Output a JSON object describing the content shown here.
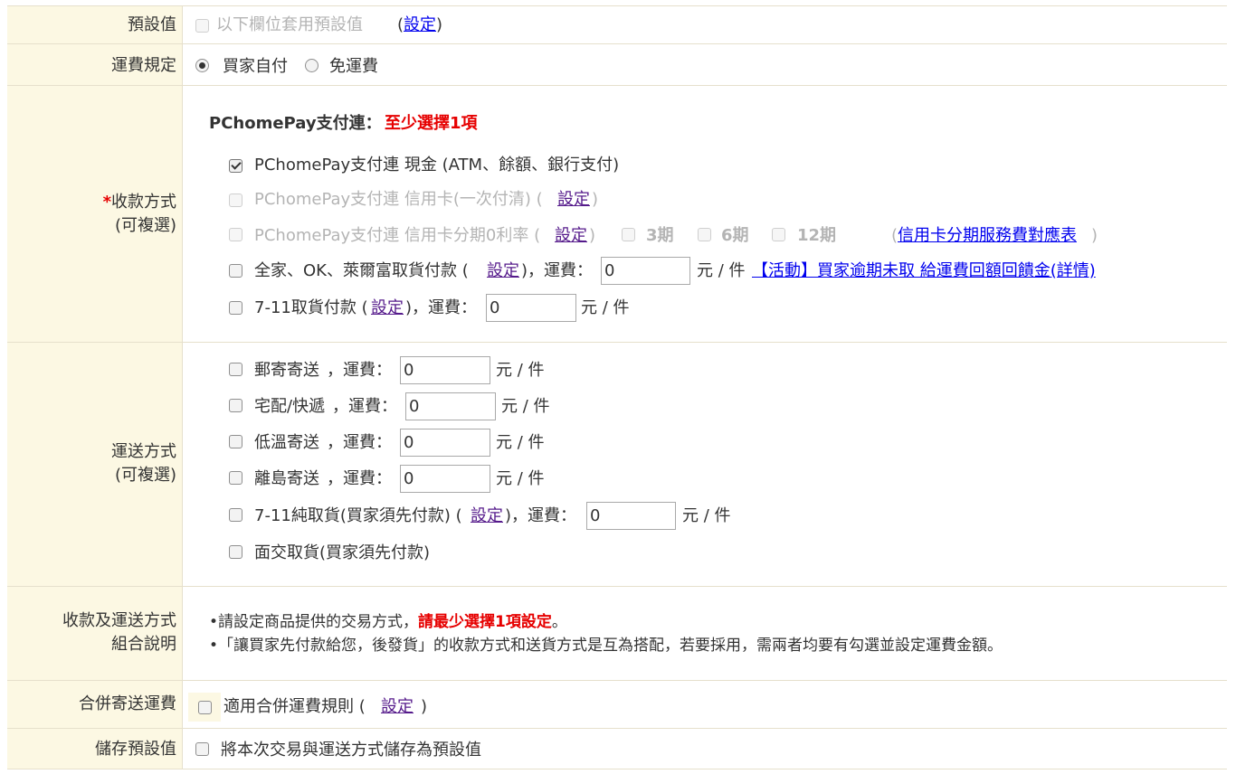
{
  "rows": {
    "default": {
      "label": "預設值",
      "checkbox_label": "以下欄位套用預設值",
      "paren_open": "(",
      "setting_link": "設定",
      "paren_close": ")"
    },
    "shipping_rule": {
      "label": "運費規定",
      "option_buyer_pays": "買家自付",
      "option_free": "免運費",
      "selected": "買家自付"
    },
    "payment": {
      "required_star": "*",
      "label_line1": "收款方式",
      "label_line2": "(可複選)",
      "group_title": "PChomePay支付連：",
      "group_requirement": "至少選擇1項",
      "cash": {
        "label": "PChomePay支付連 現金 (ATM、餘額、銀行支付)",
        "checked": true
      },
      "credit_card": {
        "label": "PChomePay支付連 信用卡(一次付清) (",
        "setting_link": "設定",
        "close": ")"
      },
      "installment": {
        "label": "PChomePay支付連 信用卡分期0利率 (",
        "setting_link": "設定",
        "close": ")",
        "option_3": "3期",
        "option_6": "6期",
        "option_12": "12期",
        "table_open": "(",
        "table_link": "信用卡分期服務費對應表",
        "table_close": ")"
      },
      "family_mart": {
        "label": "全家、OK、萊爾富取貨付款 (",
        "setting_link": "設定",
        "fee_label": ")，運費：",
        "fee_value": "0",
        "unit": "元 / 件",
        "promo_link": "【活動】買家逾期未取 給運費回額回饋金(詳情)"
      },
      "seven_eleven": {
        "label": "7-11取貨付款 (",
        "setting_link": "設定",
        "fee_label": ")，運費：",
        "fee_value": "0",
        "unit": "元 / 件"
      }
    },
    "delivery": {
      "label_line1": "運送方式",
      "label_line2": "(可複選)",
      "post": {
        "label": "郵寄寄送",
        "fee_label": "，運費：",
        "fee_value": "0",
        "unit": "元 / 件"
      },
      "home": {
        "label": "宅配/快遞",
        "fee_label": "，運費：",
        "fee_value": "0",
        "unit": "元 / 件"
      },
      "cold": {
        "label": "低溫寄送",
        "fee_label": "，運費：",
        "fee_value": "0",
        "unit": "元 / 件"
      },
      "island": {
        "label": "離島寄送",
        "fee_label": "，運費：",
        "fee_value": "0",
        "unit": "元 / 件"
      },
      "seven_pickup": {
        "label": "7-11純取貨(買家須先付款) (",
        "setting_link": "設定",
        "fee_label": ")，運費：",
        "fee_value": "0",
        "unit": "元 / 件"
      },
      "meetup": {
        "label": "面交取貨(買家須先付款)"
      }
    },
    "combo": {
      "label_line1": "收款及運送方式",
      "label_line2": "組合說明",
      "note1_prefix": "•請設定商品提供的交易方式，",
      "note1_emphasis": "請最少選擇1項設定",
      "note1_suffix": "。",
      "note2": "•「讓買家先付款給您，後發貨」的收款方式和送貨方式是互為搭配，若要採用，需兩者均要有勾選並設定運費金額。"
    },
    "merge": {
      "label": "合併寄送運費",
      "checkbox_label": "適用合併運費規則 (",
      "setting_link": "設定",
      "close": ")"
    },
    "save": {
      "label": "儲存預設值",
      "checkbox_label": "將本次交易與運送方式儲存為預設值"
    }
  }
}
